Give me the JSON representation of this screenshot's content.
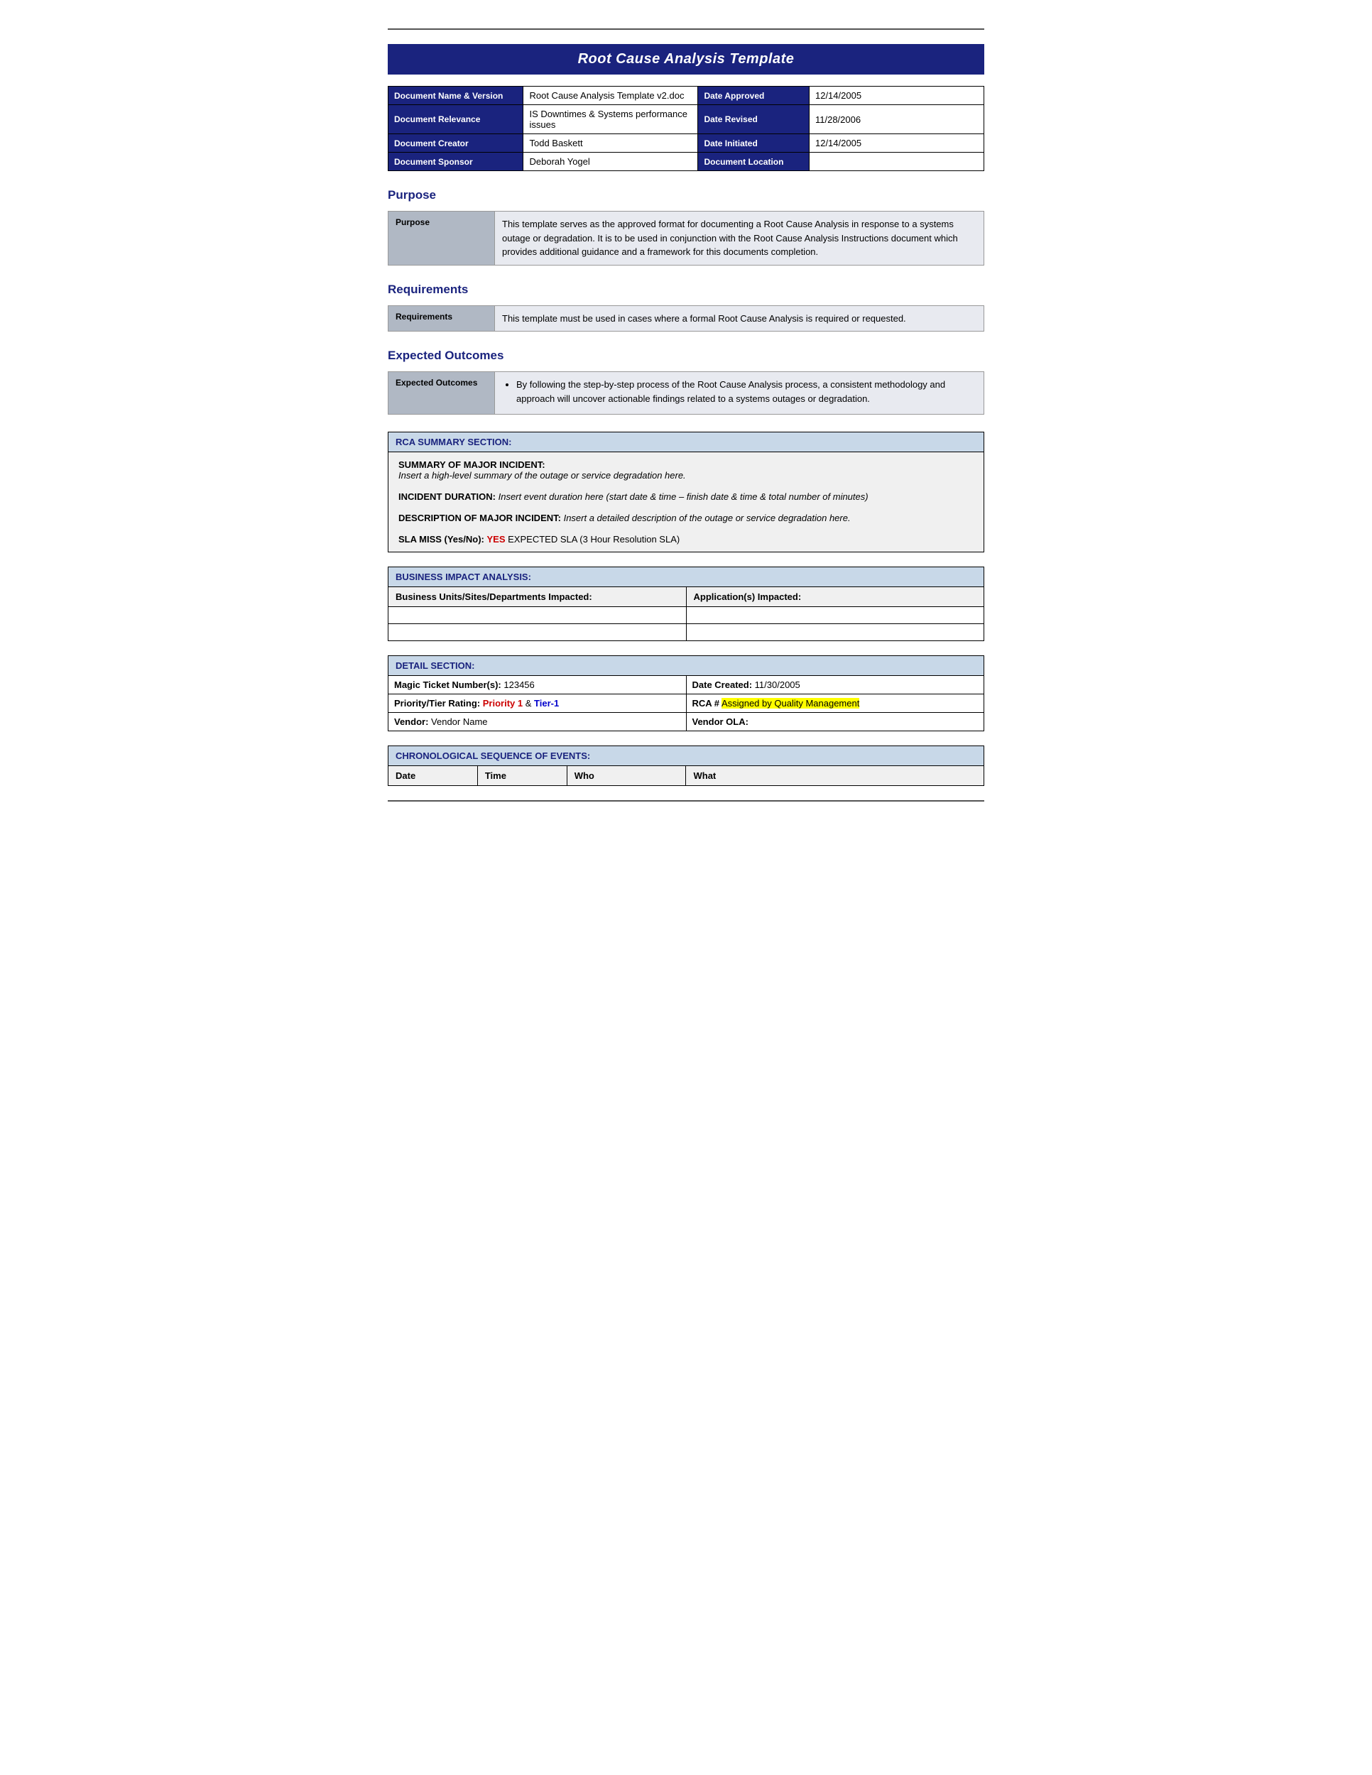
{
  "page": {
    "top_rule": true,
    "title": "Root Cause Analysis Template"
  },
  "meta": {
    "left_rows": [
      {
        "label": "Document Name & Version",
        "value": "Root Cause Analysis Template v2.doc"
      },
      {
        "label": "Document Relevance",
        "value": "IS Downtimes & Systems performance issues"
      },
      {
        "label": "Document Creator",
        "value": "Todd Baskett"
      },
      {
        "label": "Document Sponsor",
        "value": "Deborah Yogel"
      }
    ],
    "right_rows": [
      {
        "label": "Date Approved",
        "value": "12/14/2005"
      },
      {
        "label": "Date Revised",
        "value": "11/28/2006"
      },
      {
        "label": "Date Initiated",
        "value": "12/14/2005"
      },
      {
        "label": "Document Location",
        "value": ""
      }
    ]
  },
  "sections": {
    "purpose": {
      "heading": "Purpose",
      "label": "Purpose",
      "content": "This template serves as the approved format for documenting a Root Cause Analysis in response to a systems outage or degradation. It is to be used in conjunction with the Root Cause Analysis Instructions document which provides additional guidance and a framework for this documents completion."
    },
    "requirements": {
      "heading": "Requirements",
      "label": "Requirements",
      "content": "This template must be used in cases where a formal Root Cause Analysis is required or requested."
    },
    "expected_outcomes": {
      "heading": "Expected Outcomes",
      "label": "Expected Outcomes",
      "bullet": "By following the step-by-step process of the Root Cause Analysis process, a consistent methodology and approach will uncover actionable findings related to a systems outages or degradation."
    }
  },
  "rca_summary": {
    "header": "RCA SUMMARY SECTION:",
    "summary_header": "SUMMARY OF MAJOR INCIDENT:",
    "summary_content": "Insert a high-level summary of the outage or service degradation here.",
    "incident_label": "INCIDENT DURATION:",
    "incident_content": "Insert event duration here (start date &  time – finish date & time & total number of minutes)",
    "description_label": "DESCRIPTION OF MAJOR INCIDENT:",
    "description_content": "Insert a detailed description of the outage or service degradation here.",
    "sla_label": "SLA MISS (Yes/No):",
    "sla_value": "YES",
    "sla_suffix": "   EXPECTED SLA (3 Hour Resolution SLA)"
  },
  "business_impact": {
    "header": "BUSINESS IMPACT ANALYSIS:",
    "col1": "Business Units/Sites/Departments Impacted:",
    "col2": "Application(s) Impacted:"
  },
  "detail_section": {
    "header": "DETAIL SECTION:",
    "magic_label": "Magic Ticket Number(s):",
    "magic_value": "123456",
    "date_created_label": "Date Created:",
    "date_created_value": "11/30/2005",
    "priority_label": "Priority/Tier Rating:",
    "priority_text": "Priority 1",
    "priority_separator": " & ",
    "tier_text": "Tier-1",
    "rca_label": "RCA #",
    "rca_highlight_text": "Assigned by Quality Management",
    "vendor_label": "Vendor:",
    "vendor_value": "Vendor Name",
    "vendor_ola_label": "Vendor OLA:",
    "vendor_ola_value": ""
  },
  "chronological": {
    "header": "CHRONOLOGICAL SEQUENCE OF EVENTS:",
    "columns": [
      "Date",
      "Time",
      "Who",
      "What"
    ]
  }
}
